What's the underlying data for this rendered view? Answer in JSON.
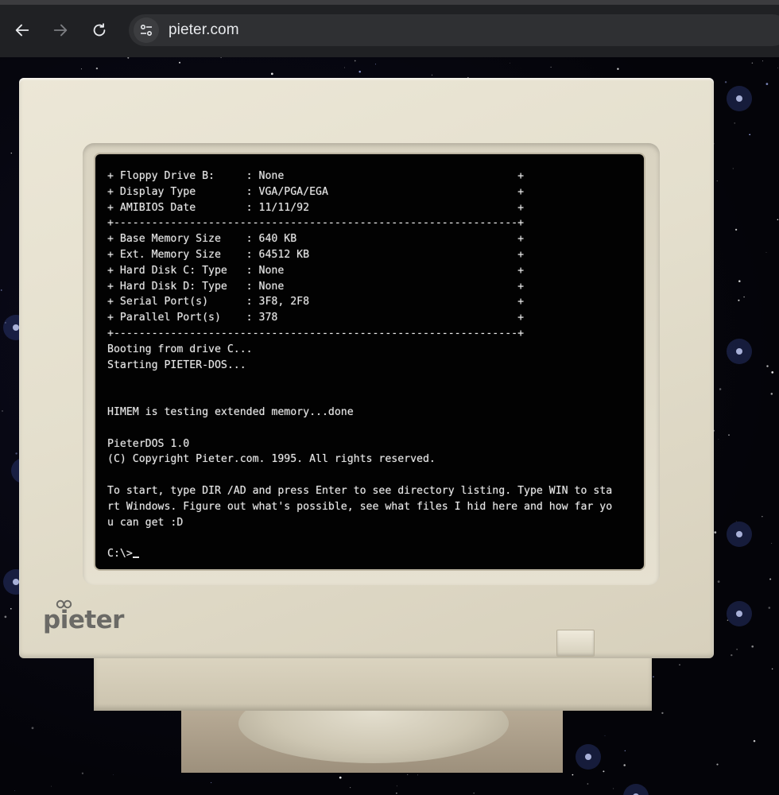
{
  "browser": {
    "url": "pieter.com",
    "icons": {
      "back": "arrow-left-icon",
      "forward": "arrow-right-icon",
      "reload": "reload-icon",
      "site_info": "tune-icon"
    }
  },
  "monitor": {
    "brand_logo": "pieter",
    "colors": {
      "case": "#e6e1cf",
      "screen": "#020202",
      "text": "#e6e6e6"
    }
  },
  "terminal": {
    "lines": [
      "+ Floppy Drive B:     : None                                     +",
      "+ Display Type        : VGA/PGA/EGA                              +",
      "+ AMIBIOS Date        : 11/11/92                                 +",
      "+----------------------------------------------------------------+",
      "+ Base Memory Size    : 640 KB                                   +",
      "+ Ext. Memory Size    : 64512 KB                                 +",
      "+ Hard Disk C: Type   : None                                     +",
      "+ Hard Disk D: Type   : None                                     +",
      "+ Serial Port(s)      : 3F8, 2F8                                 +",
      "+ Parallel Port(s)    : 378                                      +",
      "+----------------------------------------------------------------+",
      "Booting from drive C...",
      "Starting PIETER-DOS...",
      "",
      "",
      "HIMEM is testing extended memory...done",
      "",
      "PieterDOS 1.0",
      "(C) Copyright Pieter.com. 1995. All rights reserved.",
      "",
      "To start, type DIR /AD and press Enter to see directory listing. Type WIN to sta",
      "rt Windows. Figure out what's possible, see what files I hid here and how far yo",
      "u can get :D",
      ""
    ],
    "prompt": "C:\\>"
  }
}
